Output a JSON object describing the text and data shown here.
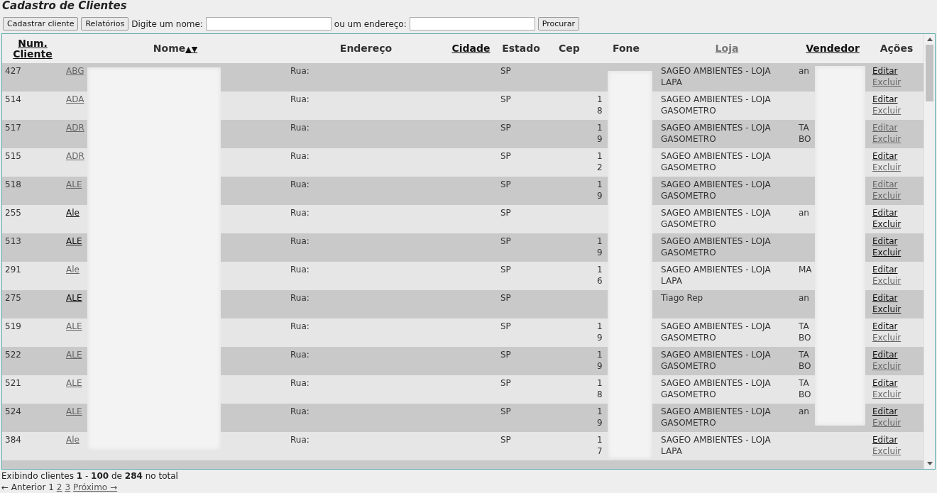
{
  "title": "Cadastro de Clientes",
  "toolbar": {
    "buttons": [
      "Cadastrar cliente",
      "Relatórios"
    ],
    "name_label": "Digite um nome:",
    "address_label": "ou um endereço:",
    "search_button": "Procurar"
  },
  "columns": [
    {
      "label": "Num. Cliente",
      "kind": "link",
      "visited": false
    },
    {
      "label": "Nome",
      "kind": "sort",
      "visited": false,
      "sort_icon": "▲▼"
    },
    {
      "label": "Endereço",
      "kind": "plain",
      "visited": false
    },
    {
      "label": "Cidade",
      "kind": "link",
      "visited": false
    },
    {
      "label": "Estado",
      "kind": "plain",
      "visited": false
    },
    {
      "label": "Cep",
      "kind": "plain",
      "visited": false
    },
    {
      "label": "Fone",
      "kind": "plain",
      "visited": false
    },
    {
      "label": "Loja",
      "kind": "link",
      "visited": true
    },
    {
      "label": "Vendedor",
      "kind": "link",
      "visited": false
    },
    {
      "label": "Ações",
      "kind": "plain",
      "visited": false
    }
  ],
  "rows": [
    {
      "num": "427",
      "name": "ABG",
      "name_visited": true,
      "endereco": "Rua:",
      "estado": "SP",
      "fone": [],
      "loja": "SAGEO AMBIENTES - LOJA LAPA",
      "vendedor": [
        "an"
      ],
      "edit": "Editar",
      "edit_visited": false,
      "delete": "Excluir",
      "delete_visited": true
    },
    {
      "num": "514",
      "name": "ADA",
      "name_visited": true,
      "endereco": "Rua:",
      "estado": "SP",
      "fone": [
        "1",
        "8"
      ],
      "loja": "SAGEO AMBIENTES - LOJA GASOMETRO",
      "vendedor": [],
      "edit": "Editar",
      "edit_visited": false,
      "delete": "Excluir",
      "delete_visited": true
    },
    {
      "num": "517",
      "name": "ADR",
      "name_visited": true,
      "endereco": "Rua:",
      "estado": "SP",
      "fone": [
        "1",
        "9"
      ],
      "loja": "SAGEO AMBIENTES - LOJA GASOMETRO",
      "vendedor": [
        "TA",
        "BO"
      ],
      "edit": "Editar",
      "edit_visited": true,
      "delete": "Excluir",
      "delete_visited": true
    },
    {
      "num": "515",
      "name": "ADR",
      "name_visited": true,
      "endereco": "Rua:",
      "estado": "SP",
      "fone": [
        "1",
        "2"
      ],
      "loja": "SAGEO AMBIENTES - LOJA GASOMETRO",
      "vendedor": [],
      "edit": "Editar",
      "edit_visited": false,
      "delete": "Excluir",
      "delete_visited": true
    },
    {
      "num": "518",
      "name": "ALE",
      "name_visited": true,
      "endereco": "Rua:",
      "estado": "SP",
      "fone": [
        "1",
        "9"
      ],
      "loja": "SAGEO AMBIENTES - LOJA GASOMETRO",
      "vendedor": [],
      "edit": "Editar",
      "edit_visited": true,
      "delete": "Excluir",
      "delete_visited": true
    },
    {
      "num": "255",
      "name": "Ale",
      "name_visited": false,
      "endereco": "Rua:",
      "estado": "SP",
      "fone": [],
      "loja": "SAGEO AMBIENTES - LOJA GASOMETRO",
      "vendedor": [
        "an"
      ],
      "edit": "Editar",
      "edit_visited": false,
      "delete": "Excluir",
      "delete_visited": false
    },
    {
      "num": "513",
      "name": "ALE",
      "name_visited": false,
      "endereco": "Rua:",
      "estado": "SP",
      "fone": [
        "1",
        "9"
      ],
      "loja": "SAGEO AMBIENTES - LOJA GASOMETRO",
      "vendedor": [],
      "edit": "Editar",
      "edit_visited": false,
      "delete": "Excluir",
      "delete_visited": false
    },
    {
      "num": "291",
      "name": "Ale",
      "name_visited": true,
      "endereco": "Rua:",
      "estado": "SP",
      "fone": [
        "1",
        "6"
      ],
      "loja": "SAGEO AMBIENTES - LOJA LAPA",
      "vendedor": [
        "MA"
      ],
      "edit": "Editar",
      "edit_visited": false,
      "delete": "Excluir",
      "delete_visited": true
    },
    {
      "num": "275",
      "name": "ALE",
      "name_visited": false,
      "endereco": "Rua:",
      "estado": "SP",
      "fone": [],
      "loja": "Tiago Rep",
      "vendedor": [
        "an"
      ],
      "edit": "Editar",
      "edit_visited": false,
      "delete": "Excluir",
      "delete_visited": false
    },
    {
      "num": "519",
      "name": "ALE",
      "name_visited": true,
      "endereco": "Rua:",
      "estado": "SP",
      "fone": [
        "1",
        "9"
      ],
      "loja": "SAGEO AMBIENTES - LOJA GASOMETRO",
      "vendedor": [
        "TA",
        "BO"
      ],
      "edit": "Editar",
      "edit_visited": false,
      "delete": "Excluir",
      "delete_visited": true
    },
    {
      "num": "522",
      "name": "ALE",
      "name_visited": true,
      "endereco": "Rua:",
      "estado": "SP",
      "fone": [
        "1",
        "9"
      ],
      "loja": "SAGEO AMBIENTES - LOJA GASOMETRO",
      "vendedor": [
        "TA",
        "BO"
      ],
      "edit": "Editar",
      "edit_visited": false,
      "delete": "Excluir",
      "delete_visited": true
    },
    {
      "num": "521",
      "name": "ALE",
      "name_visited": true,
      "endereco": "Rua:",
      "estado": "SP",
      "fone": [
        "1",
        "8"
      ],
      "loja": "SAGEO AMBIENTES - LOJA GASOMETRO",
      "vendedor": [
        "TA",
        "BO"
      ],
      "edit": "Editar",
      "edit_visited": false,
      "delete": "Excluir",
      "delete_visited": true
    },
    {
      "num": "524",
      "name": "ALE",
      "name_visited": true,
      "endereco": "Rua:",
      "estado": "SP",
      "fone": [
        "1",
        "9"
      ],
      "loja": "SAGEO AMBIENTES - LOJA GASOMETRO",
      "vendedor": [
        "an"
      ],
      "edit": "Editar",
      "edit_visited": false,
      "delete": "Excluir",
      "delete_visited": true
    },
    {
      "num": "384",
      "name": "Ale",
      "name_visited": true,
      "endereco": "Rua:",
      "estado": "SP",
      "fone": [
        "1",
        "7"
      ],
      "loja": "SAGEO AMBIENTES - LOJA LAPA",
      "vendedor": [],
      "edit": "Editar",
      "edit_visited": false,
      "delete": "Excluir",
      "delete_visited": true
    }
  ],
  "summary": "Exibindo clientes **1** - **100** de **284** no total",
  "pager": {
    "prev": "← Anterior",
    "current": "1",
    "pages": [
      "2",
      "3"
    ],
    "next": "Próximo →"
  }
}
